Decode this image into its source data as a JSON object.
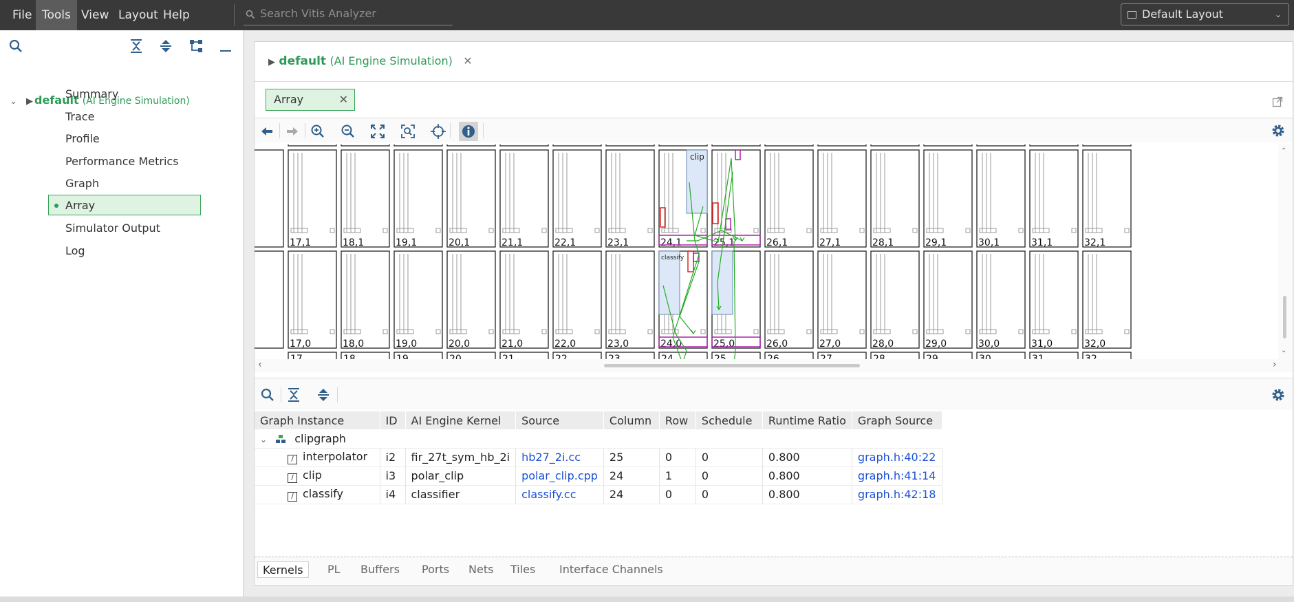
{
  "menubar": {
    "items": [
      "File",
      "Tools",
      "View",
      "Layout",
      "Help"
    ],
    "active": "Tools",
    "search_placeholder": "Search Vitis Analyzer",
    "layout_select": "Default Layout"
  },
  "sidebar": {
    "root": {
      "name": "default",
      "subtitle": "(AI Engine Simulation)"
    },
    "items": [
      "Summary",
      "Trace",
      "Profile",
      "Performance Metrics",
      "Graph",
      "Array",
      "Simulator Output",
      "Log"
    ],
    "active_item": "Array"
  },
  "document": {
    "name": "default",
    "subtitle": "(AI Engine Simulation)",
    "tab": "Array"
  },
  "array_view": {
    "columns": [
      "17",
      "18",
      "19",
      "20",
      "21",
      "22",
      "23",
      "24",
      "25",
      "26",
      "27",
      "28",
      "29",
      "30",
      "31",
      "32"
    ],
    "row1_labels": [
      "17,1",
      "18,1",
      "19,1",
      "20,1",
      "21,1",
      "22,1",
      "23,1",
      "24,1",
      "25,1",
      "26,1",
      "27,1",
      "28,1",
      "29,1",
      "30,1",
      "31,1",
      "32,1"
    ],
    "row0_labels": [
      "17,0",
      "18,0",
      "19,0",
      "20,0",
      "21,0",
      "22,0",
      "23,0",
      "24,0",
      "25,0",
      "26,0",
      "27,0",
      "28,0",
      "29,0",
      "30,0",
      "31,0",
      "32,0"
    ],
    "kernel_labels": {
      "clip": "clip",
      "classify": "classify"
    }
  },
  "kernel_table": {
    "headers": [
      "Graph Instance",
      "ID",
      "AI Engine Kernel",
      "Source",
      "Column",
      "Row",
      "Schedule",
      "Runtime Ratio",
      "Graph Source"
    ],
    "group": "clipgraph",
    "rows": [
      {
        "instance": "interpolator",
        "id": "i2",
        "kernel": "fir_27t_sym_hb_2i",
        "source": "hb27_2i.cc",
        "column": "25",
        "row": "0",
        "schedule": "0",
        "ratio": "0.800",
        "graph_source": "graph.h:40:22"
      },
      {
        "instance": "clip",
        "id": "i3",
        "kernel": "polar_clip",
        "source": "polar_clip.cpp",
        "column": "24",
        "row": "1",
        "schedule": "0",
        "ratio": "0.800",
        "graph_source": "graph.h:41:14"
      },
      {
        "instance": "classify",
        "id": "i4",
        "kernel": "classifier",
        "source": "classify.cc",
        "column": "24",
        "row": "0",
        "schedule": "0",
        "ratio": "0.800",
        "graph_source": "graph.h:42:18"
      }
    ]
  },
  "bottom_tabs": [
    "Kernels",
    "PL",
    "Buffers",
    "Ports",
    "Nets",
    "Tiles",
    "Interface Channels"
  ],
  "active_bottom_tab": "Kernels",
  "colors": {
    "accent": "#2d9a57",
    "link": "#1a4fd6",
    "menubar": "#393939",
    "route": "#22aa22",
    "kernel_fill": "#dce8f7",
    "buffer": "#dd2222",
    "port": "#aa22aa"
  },
  "icons": [
    "search-icon",
    "collapse-all-icon",
    "expand-all-icon",
    "hierarchy-icon",
    "minimize-icon",
    "back-icon",
    "forward-icon",
    "zoom-in-icon",
    "zoom-out-icon",
    "fit-icon",
    "zoom-fit-selection-icon",
    "center-icon",
    "info-icon",
    "gear-icon",
    "popout-icon",
    "close-icon",
    "chevron-down-icon",
    "kernel-file-icon",
    "graph-group-icon"
  ]
}
